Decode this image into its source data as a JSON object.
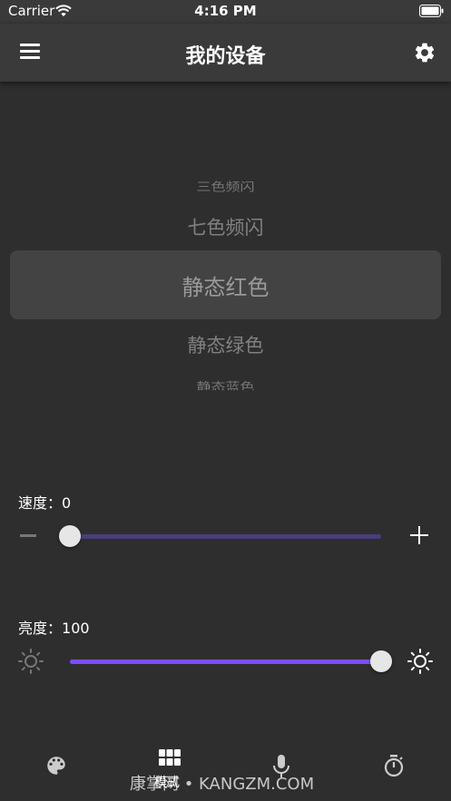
{
  "status_bar": {
    "carrier": "Carrier",
    "time": "4:16 PM"
  },
  "nav": {
    "title": "我的设备"
  },
  "picker": {
    "items": [
      "三色频闪",
      "七色频闪",
      "静态红色",
      "静态绿色",
      "静态蓝色"
    ],
    "selected_index": 2
  },
  "speed": {
    "label": "速度：",
    "value": "0",
    "fraction": 0.0
  },
  "brightness": {
    "label": "亮度：",
    "value": "100",
    "fraction": 1.0
  },
  "tabs": [
    {
      "icon": "palette-icon"
    },
    {
      "icon": "grid-icon",
      "label": "模式",
      "active": true
    },
    {
      "icon": "microphone-icon"
    },
    {
      "icon": "timer-icon"
    }
  ],
  "watermark": "康掌网 • KANGZM.COM",
  "colors": {
    "accent": "#7c4dff",
    "background": "#2e2e2f",
    "bar": "#3a3a3b"
  }
}
